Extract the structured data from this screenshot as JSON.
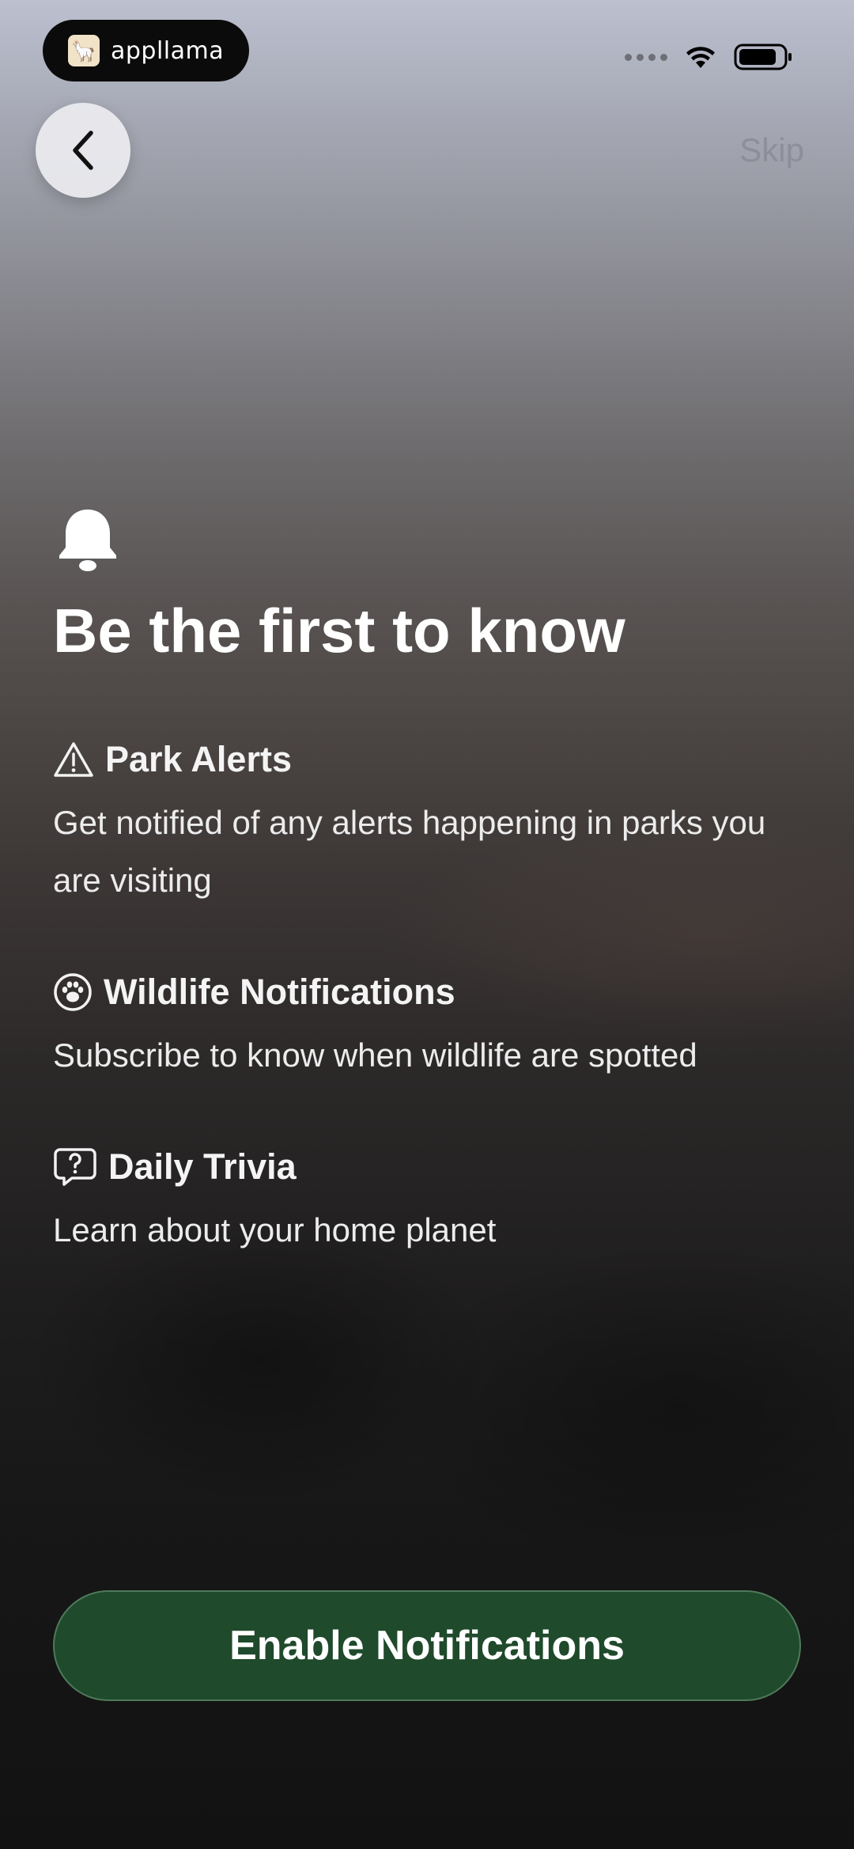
{
  "status_bar": {
    "app_name": "appllama",
    "logo_icon": "llama-icon"
  },
  "nav": {
    "back_icon": "chevron-left-icon",
    "skip_label": "Skip"
  },
  "main": {
    "hero_icon": "bell-icon",
    "title": "Be the first to know",
    "features": [
      {
        "icon": "warning-triangle-icon",
        "title": "Park Alerts",
        "description": "Get notified of any alerts happening in parks you are visiting"
      },
      {
        "icon": "paw-icon",
        "title": "Wildlife Notifications",
        "description": "Subscribe to know when wildlife are spotted"
      },
      {
        "icon": "question-bubble-icon",
        "title": "Daily Trivia",
        "description": "Learn about your home planet"
      }
    ]
  },
  "cta": {
    "label": "Enable Notifications"
  },
  "colors": {
    "cta_background": "#1f4a2b",
    "skip_text": "#8c8f99"
  }
}
